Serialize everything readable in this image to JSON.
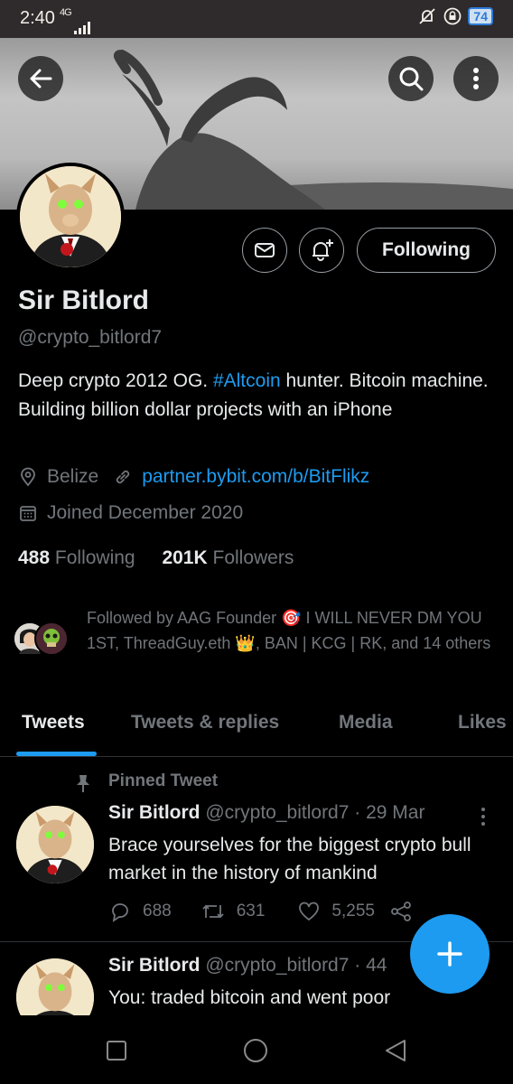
{
  "status_bar": {
    "time": "2:40",
    "network": "4G",
    "battery": "74"
  },
  "profile": {
    "name": "Sir Bitlord",
    "handle": "@crypto_bitlord7",
    "bio_part1": "Deep crypto 2012 OG. ",
    "bio_hashtag": "#Altcoin",
    "bio_part2": " hunter. Bitcoin machine. Building billion dollar projects with an iPhone",
    "location": "Belize",
    "website": "partner.bybit.com/b/BitFlikz",
    "joined": "Joined December 2020",
    "following_count": "488",
    "following_label": "Following",
    "followers_count": "201K",
    "followers_label": "Followers",
    "followed_by": "Followed by AAG Founder 🎯 I WILL NEVER DM YOU 1ST, ThreadGuy.eth 👑, BAN | KCG | RK, and 14 others"
  },
  "actions": {
    "follow_state": "Following"
  },
  "tabs": [
    {
      "label": "Tweets",
      "active": true
    },
    {
      "label": "Tweets & replies",
      "active": false
    },
    {
      "label": "Media",
      "active": false
    },
    {
      "label": "Likes",
      "active": false
    }
  ],
  "tweets": [
    {
      "pinned_label": "Pinned Tweet",
      "author": "Sir Bitlord",
      "handle": "@crypto_bitlord7",
      "date": "· 29 Mar",
      "text": "Brace yourselves for the biggest crypto bull market in the history of mankind",
      "replies": "688",
      "retweets": "631",
      "likes": "5,255"
    },
    {
      "author": "Sir Bitlord",
      "handle": "@crypto_bitlord7",
      "date": "· 44",
      "text": "You: traded bitcoin and went poor"
    }
  ],
  "colors": {
    "accent": "#1d9bf0",
    "background": "#000000",
    "muted": "#71767b"
  }
}
